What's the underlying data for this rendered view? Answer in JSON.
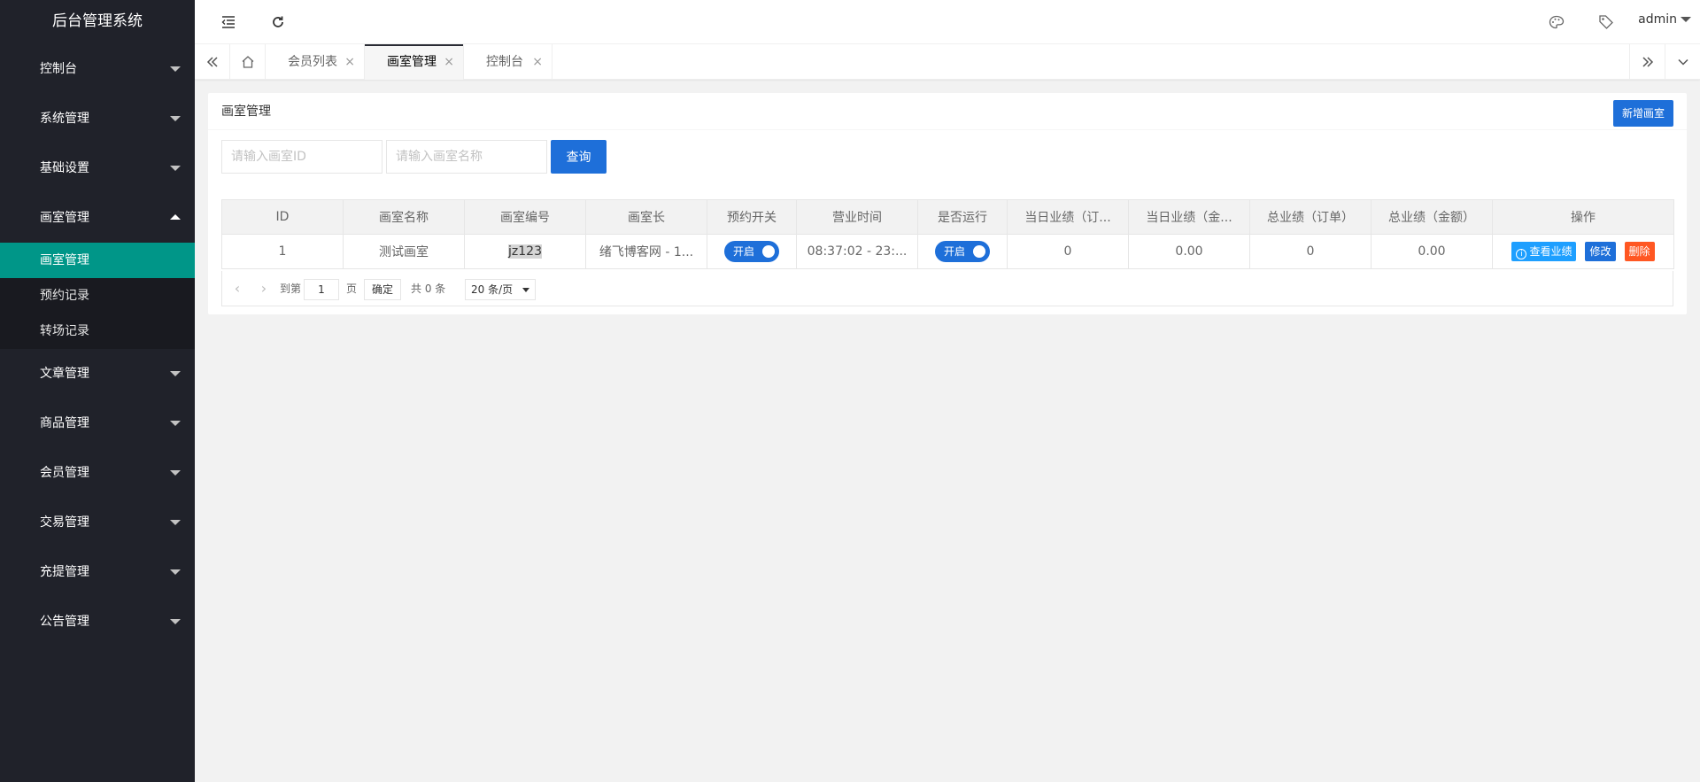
{
  "app": {
    "title": "后台管理系统"
  },
  "sidebar": {
    "items": [
      {
        "label": "控制台",
        "open": false
      },
      {
        "label": "系统管理",
        "open": false
      },
      {
        "label": "基础设置",
        "open": false
      },
      {
        "label": "画室管理",
        "open": true
      },
      {
        "label": "文章管理",
        "open": false
      },
      {
        "label": "商品管理",
        "open": false
      },
      {
        "label": "会员管理",
        "open": false
      },
      {
        "label": "交易管理",
        "open": false
      },
      {
        "label": "充提管理",
        "open": false
      },
      {
        "label": "公告管理",
        "open": false
      }
    ],
    "submenu": [
      {
        "label": "画室管理",
        "active": true
      },
      {
        "label": "预约记录",
        "active": false
      },
      {
        "label": "转场记录",
        "active": false
      }
    ]
  },
  "header": {
    "user": "admin",
    "icons": [
      "menu-toggle-icon",
      "refresh-icon",
      "palette-icon",
      "tag-icon"
    ]
  },
  "tabs": {
    "items": [
      {
        "label": "会员列表",
        "active": false
      },
      {
        "label": "画室管理",
        "active": true
      },
      {
        "label": "控制台",
        "active": false
      }
    ],
    "close_glyph": "×"
  },
  "main": {
    "card_title": "画室管理",
    "add_button": "新增画室",
    "search": {
      "id_placeholder": "请输入画室ID",
      "name_placeholder": "请输入画室名称",
      "button": "查询"
    },
    "table": {
      "headers": [
        "ID",
        "画室名称",
        "画室编号",
        "画室长",
        "预约开关",
        "营业时间",
        "是否运行",
        "当日业绩（订...",
        "当日业绩（金...",
        "总业绩（订单）",
        "总业绩（金额）",
        "操作"
      ],
      "rows": [
        {
          "id": "1",
          "name": "测试画室",
          "code": "jz123",
          "owner": "绪飞博客网 - 1...",
          "booking_switch": "开启",
          "hours": "08:37:02 - 23:...",
          "running_switch": "开启",
          "today_orders": "0",
          "today_amount": "0.00",
          "total_orders": "0",
          "total_amount": "0.00",
          "actions": {
            "view": "查看业绩",
            "edit": "修改",
            "delete": "删除"
          }
        }
      ]
    },
    "pager": {
      "goto_label": "到第",
      "page_value": "1",
      "page_unit": "页",
      "confirm": "确定",
      "total": "共 0 条",
      "page_size": "20 条/页"
    }
  },
  "colors": {
    "sidebar_bg": "#20222a",
    "active_submenu": "#009688",
    "primary": "#1e6fd9",
    "view_btn": "#1e9fff",
    "danger_btn": "#ff5722"
  }
}
